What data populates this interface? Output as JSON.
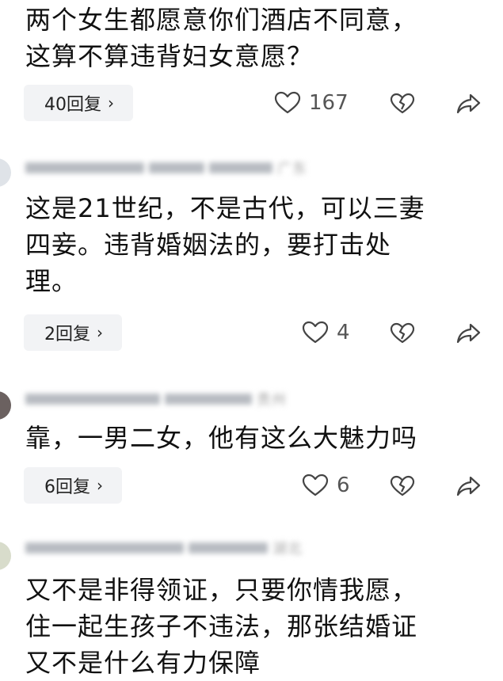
{
  "comments": [
    {
      "author": "",
      "time": "",
      "location": "",
      "text_lines": [
        "两个女生都愿意你们酒店不同意，",
        "这算不算违背妇女意愿？"
      ],
      "replies": "40回复",
      "likes": "167"
    },
    {
      "author": "",
      "time": "",
      "location": "广东",
      "text_lines": [
        "这是21世纪，不是古代，可以三妻",
        "四妾。违背婚姻法的，要打击处",
        "理。"
      ],
      "replies": "2回复",
      "likes": "4"
    },
    {
      "author": "",
      "time": "",
      "location": "贵州",
      "text_lines": [
        "靠，一男二女，他有这么大魅力吗"
      ],
      "replies": "6回复",
      "likes": "6"
    },
    {
      "author": "",
      "time": "",
      "location": "湖北",
      "text_lines": [
        "又不是非得领证，只要你情我愿，",
        "住一起生孩子不违法，那张结婚证",
        "又不是什么有力保障"
      ],
      "replies": "",
      "likes": ""
    }
  ],
  "icons": {
    "like": "heart-outline-icon",
    "dislike": "broken-heart-icon",
    "share": "share-arrow-icon",
    "reply_chevron": "›"
  },
  "colors": {
    "reply_bg": "#f2f3f5",
    "icon": "#444444"
  }
}
